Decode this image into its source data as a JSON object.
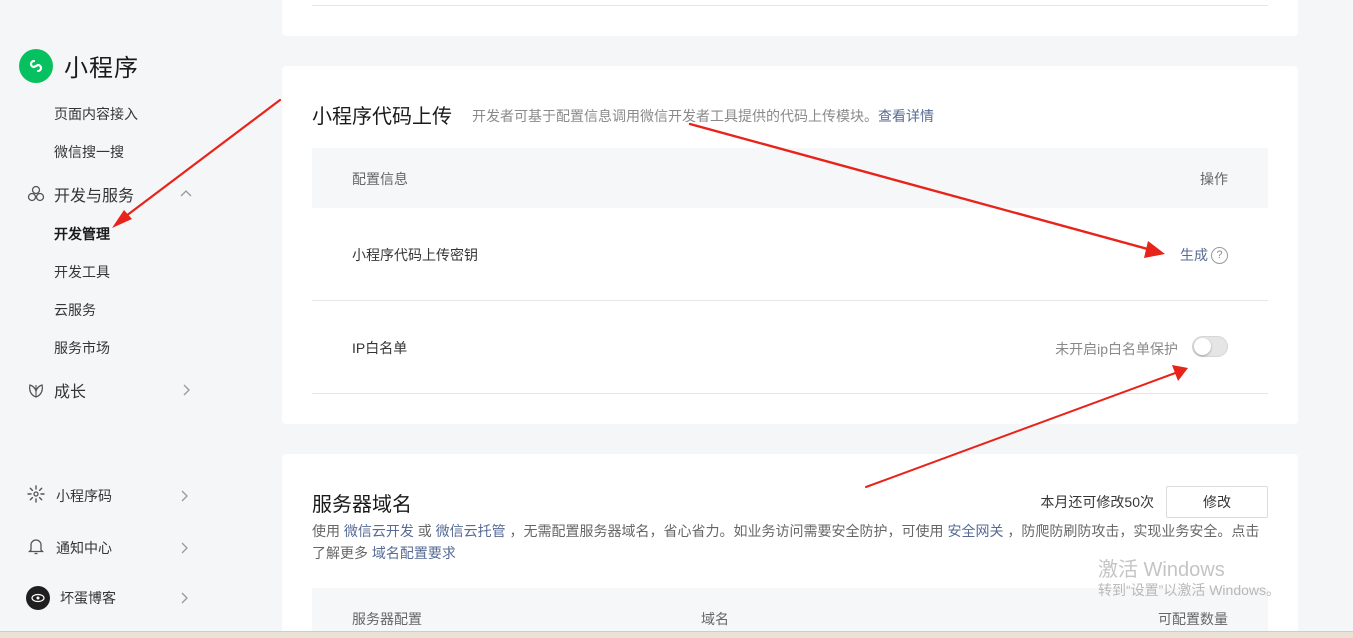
{
  "sidebar": {
    "brand": {
      "icon": "miniprogram-icon",
      "name": "小程序"
    },
    "top_items": [
      {
        "label": "页面内容接入"
      },
      {
        "label": "微信搜一搜"
      }
    ],
    "dev_group": {
      "label": "开发与服务",
      "icon": "cluster-icon",
      "expanded": true
    },
    "dev_items": [
      {
        "label": "开发管理",
        "active": true
      },
      {
        "label": "开发工具"
      },
      {
        "label": "云服务"
      },
      {
        "label": "服务市场"
      }
    ],
    "growth_group": {
      "label": "成长",
      "icon": "leaf-icon"
    },
    "bottom_items": [
      {
        "label": "小程序码",
        "icon": "qrcode-icon"
      },
      {
        "label": "通知中心",
        "icon": "bell-icon"
      },
      {
        "label": "坏蛋博客",
        "icon": "avatar"
      }
    ]
  },
  "upload": {
    "title": "小程序代码上传",
    "desc": "开发者可基于配置信息调用微信开发者工具提供的代码上传模块。",
    "desc_link": "查看详情",
    "table": {
      "col_config": "配置信息",
      "col_action": "操作",
      "rows": [
        {
          "label": "小程序代码上传密钥",
          "action": "生成",
          "help": "?"
        },
        {
          "label": "IP白名单",
          "status": "未开启ip白名单保护",
          "toggle_on": false
        }
      ]
    }
  },
  "domain": {
    "title": "服务器域名",
    "remain": "本月还可修改50次",
    "edit": "修改",
    "desc": {
      "p1": "使用 ",
      "link1": "微信云开发",
      "p2": " 或 ",
      "link2": "微信云托管",
      "p3": " ，无需配置服务器域名，省心省力。如业务访问需要安全防护，可使用 ",
      "link3": "安全网关",
      "p4": " ，防爬防刷防攻击，实现业务安全。点击了解更多 ",
      "link4": "域名配置要求"
    },
    "table": {
      "col_server": "服务器配置",
      "col_domain": "域名",
      "col_count": "可配置数量"
    }
  },
  "watermark": {
    "line1": "激活 Windows",
    "line2": "转到“设置”以激活 Windows。"
  },
  "colors": {
    "accent_link": "#576b95",
    "brand_green": "#07c160",
    "arrow_red": "#e8231a"
  }
}
